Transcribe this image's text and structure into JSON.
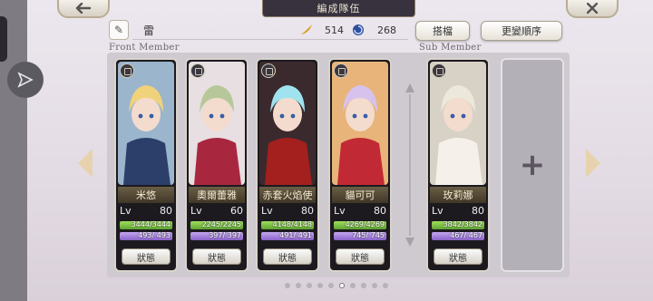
{
  "header": {
    "title": "編成隊伍",
    "back_icon": "arrow-left-icon",
    "close_icon": "close-x-icon"
  },
  "team": {
    "name": "雷"
  },
  "resources": [
    {
      "icon": "feather-icon",
      "value": "514",
      "color": "#d6a12a"
    },
    {
      "icon": "swirl-icon",
      "value": "268",
      "color": "#2d4f9e"
    }
  ],
  "buttons": {
    "pair": "搭檔",
    "reorder": "更變順序",
    "add": "+"
  },
  "labels": {
    "front": "Front Member",
    "sub": "Sub Member"
  },
  "members": [
    {
      "name": "米悠",
      "lv_label": "Lv",
      "lv": "80",
      "hp": "3444/3444",
      "mp": "493/ 493",
      "status": "狀態",
      "hair": "#f0d27a",
      "bg": "#9bb5cc",
      "outfit": "#2c3f6a"
    },
    {
      "name": "奧爾蕾雅",
      "lv_label": "Lv",
      "lv": "60",
      "hp": "2245/2245",
      "mp": "397/ 397",
      "status": "狀態",
      "hair": "#b7c79a",
      "bg": "#e7dfe1",
      "outfit": "#a8273f"
    },
    {
      "name": "赤套火焰使",
      "lv_label": "Lv",
      "lv": "80",
      "hp": "4148/4148",
      "mp": "491/ 491",
      "status": "狀態",
      "hair": "#9fe3ef",
      "bg": "#3a2a2e",
      "outfit": "#a3201e"
    },
    {
      "name": "貓可可",
      "lv_label": "Lv",
      "lv": "80",
      "hp": "4269/4269",
      "mp": "745/ 745",
      "status": "狀態",
      "hair": "#d7c2ee",
      "bg": "#e8b47a",
      "outfit": "#c12a34"
    },
    {
      "name": "玫莉娜",
      "lv_label": "Lv",
      "lv": "80",
      "hp": "3842/3842",
      "mp": "467/ 467",
      "status": "狀態",
      "hair": "#ece8dc",
      "bg": "#d8d2c6",
      "outfit": "#f5f1ea"
    }
  ],
  "pagination": {
    "pages": 10,
    "current": 6
  }
}
